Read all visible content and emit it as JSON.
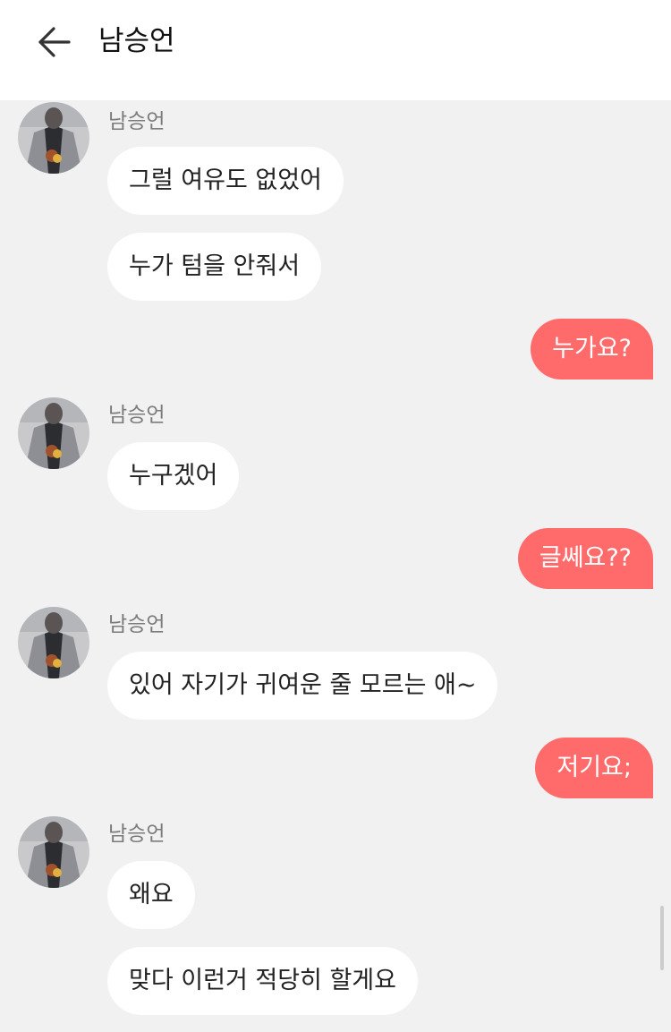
{
  "header": {
    "back_icon": "arrow-left-icon",
    "title": "남승언"
  },
  "colors": {
    "background": "#f1f1f2",
    "incoming_bubble": "#ffffff",
    "outgoing_bubble": "#ff6b6b",
    "sender_name": "#7b7b7b"
  },
  "messages": [
    {
      "sender": "남승언",
      "bubbles": [
        "그럴 여유도 없었어",
        "누가 텀을 안줘서"
      ]
    },
    {
      "me": "누가요?"
    },
    {
      "sender": "남승언",
      "bubbles": [
        "누구겠어"
      ]
    },
    {
      "me": "글쎄요??"
    },
    {
      "sender": "남승언",
      "bubbles": [
        "있어 자기가 귀여운 줄 모르는 애~"
      ]
    },
    {
      "me": "저기요;"
    },
    {
      "sender": "남승언",
      "bubbles": [
        "왜요",
        "맞다 이런거 적당히 할게요"
      ]
    }
  ]
}
